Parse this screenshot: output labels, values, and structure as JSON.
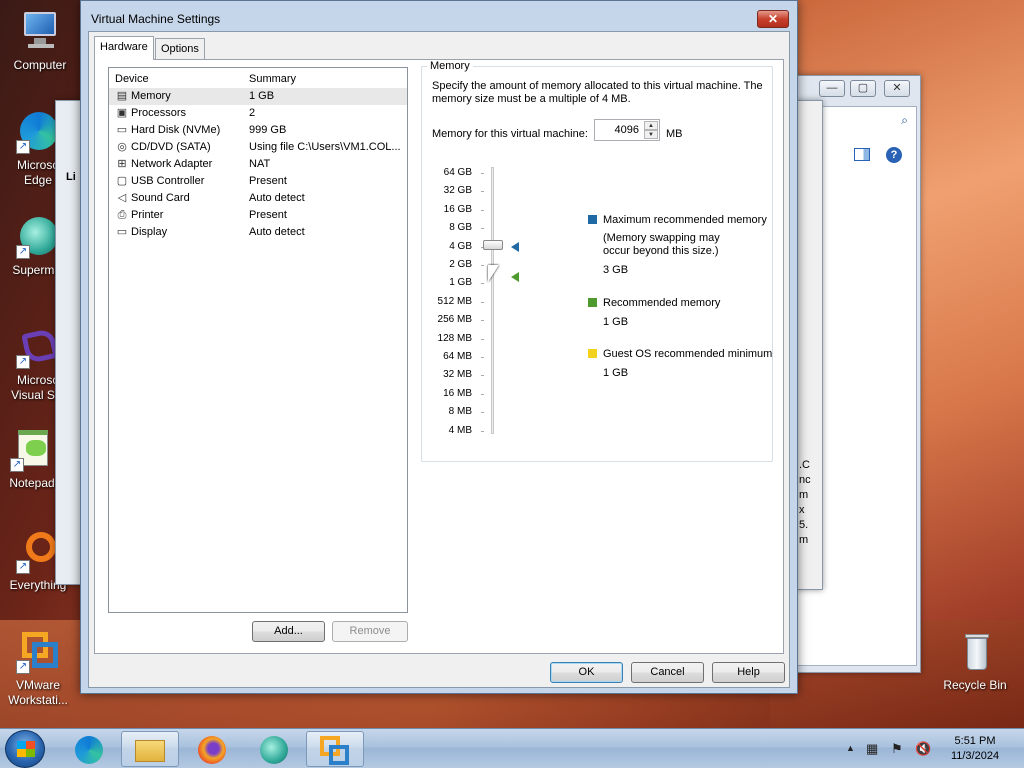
{
  "desktop": {
    "icons": [
      {
        "label": "Computer",
        "icon": "computer-icon"
      },
      {
        "label": "Microsoft Edge",
        "label_lines": [
          "Microso",
          "Edge"
        ],
        "icon": "edge-icon"
      },
      {
        "label": "Supermium",
        "label_lines": [
          "Supermiu"
        ],
        "icon": "supermium-icon"
      },
      {
        "label": "Microsoft Visual Studio",
        "label_lines": [
          "Microso",
          "Visual Stu"
        ],
        "icon": "visual-studio-icon"
      },
      {
        "label": "Notepad",
        "label_lines": [
          "Notepad"
        ],
        "icon": "notepad-icon"
      },
      {
        "label": "Everything",
        "label_lines": [
          "Everything"
        ],
        "icon": "everything-icon"
      },
      {
        "label": "VMware Workstation",
        "label_lines": [
          "VMware",
          "Workstati..."
        ],
        "icon": "vmware-icon"
      }
    ],
    "recycle_bin": "Recycle Bin"
  },
  "background_window": {
    "partial_text": [
      "Li",
      ".C",
      "nc",
      "m",
      "x",
      "5.",
      "m"
    ]
  },
  "dialog": {
    "title": "Virtual Machine Settings",
    "close_glyph": "✕",
    "tabs": [
      {
        "label": "Hardware",
        "active": true
      },
      {
        "label": "Options",
        "active": false
      }
    ],
    "device_list": {
      "col_device": "Device",
      "col_summary": "Summary",
      "rows": [
        {
          "device": "Memory",
          "summary": "1 GB",
          "icon": "memory-icon",
          "selected": true
        },
        {
          "device": "Processors",
          "summary": "2",
          "icon": "processor-icon"
        },
        {
          "device": "Hard Disk (NVMe)",
          "summary": "999 GB",
          "icon": "hard-disk-icon"
        },
        {
          "device": "CD/DVD (SATA)",
          "summary": "Using file C:\\Users\\VM1.COL...",
          "icon": "cd-dvd-icon"
        },
        {
          "device": "Network Adapter",
          "summary": "NAT",
          "icon": "network-icon"
        },
        {
          "device": "USB Controller",
          "summary": "Present",
          "icon": "usb-icon"
        },
        {
          "device": "Sound Card",
          "summary": "Auto detect",
          "icon": "sound-icon"
        },
        {
          "device": "Printer",
          "summary": "Present",
          "icon": "printer-icon"
        },
        {
          "device": "Display",
          "summary": "Auto detect",
          "icon": "display-icon"
        }
      ]
    },
    "add_button": "Add...",
    "remove_button": "Remove",
    "memory": {
      "group_label": "Memory",
      "description": "Specify the amount of memory allocated to this virtual machine. The memory size must be a multiple of 4 MB.",
      "field_label": "Memory for this virtual machine:",
      "value": "4096",
      "unit": "MB",
      "scale": [
        "64 GB",
        "32 GB",
        "16 GB",
        "8 GB",
        "4 GB",
        "2 GB",
        "1 GB",
        "512 MB",
        "256 MB",
        "128 MB",
        "64 MB",
        "32 MB",
        "16 MB",
        "8 MB",
        "4 MB"
      ],
      "legend": [
        {
          "title": "Maximum recommended memory",
          "note": "(Memory swapping may occur beyond this size.)",
          "note_lines": [
            "(Memory swapping may",
            "occur beyond this size.)"
          ],
          "value": "3 GB",
          "color": "#1f6aa5"
        },
        {
          "title": "Recommended memory",
          "value": "1 GB",
          "color": "#4f9a2e"
        },
        {
          "title": "Guest OS recommended minimum",
          "value": "1 GB",
          "color": "#f2d21c"
        }
      ]
    },
    "ok_button": "OK",
    "cancel_button": "Cancel",
    "help_button": "Help"
  },
  "taskbar": {
    "time": "5:51 PM",
    "date": "11/3/2024"
  }
}
